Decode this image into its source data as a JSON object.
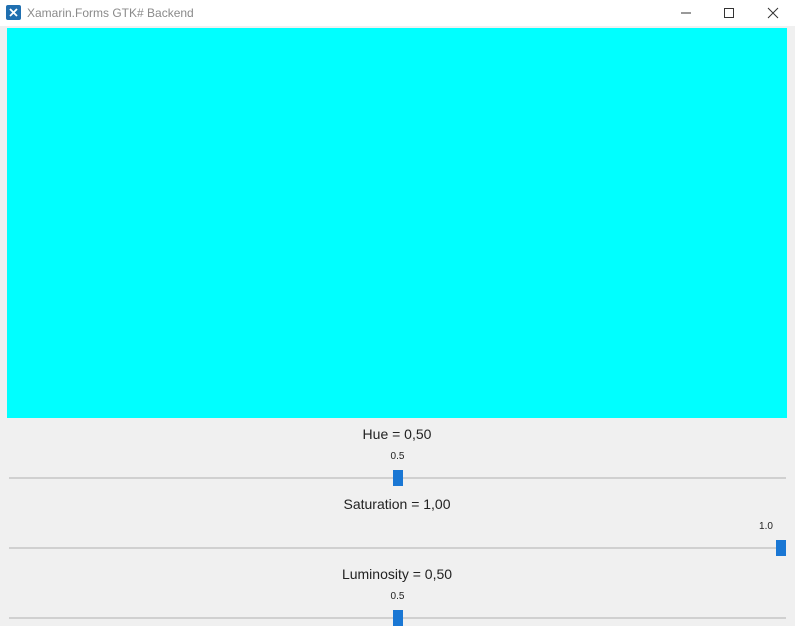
{
  "window": {
    "title": "Xamarin.Forms GTK# Backend",
    "icon": "xamarin-icon"
  },
  "preview": {
    "color": "#00ffff"
  },
  "controls": [
    {
      "key": "hue",
      "label": "Hue = 0,50",
      "value": 0.5,
      "value_text": "0.5"
    },
    {
      "key": "saturation",
      "label": "Saturation = 1,00",
      "value": 1.0,
      "value_text": "1.0"
    },
    {
      "key": "luminosity",
      "label": "Luminosity = 0,50",
      "value": 0.5,
      "value_text": "0.5"
    }
  ],
  "colors": {
    "accent": "#1a77d4",
    "track": "#d0d0d0",
    "background": "#f0f0f0"
  }
}
